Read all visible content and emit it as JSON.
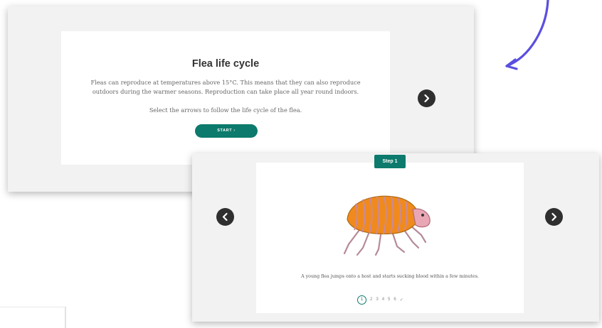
{
  "panel1": {
    "title": "Flea life cycle",
    "body": "Fleas can reproduce at temperatures above 15°C. This means that they can also reproduce outdoors during the warmer seasons. Reproduction can take place all year round indoors.",
    "instruction": "Select the arrows to follow the life cycle of the flea.",
    "start_label": "START ›"
  },
  "panel2": {
    "step_badge": "Step 1",
    "caption": "A young flea jumps onto a host and starts sucking blood within a few minutes.",
    "pager": {
      "current": "1",
      "pages": [
        "2",
        "3",
        "4",
        "5",
        "6"
      ],
      "done_glyph": "✓"
    }
  },
  "icons": {
    "next": "chevron-right-icon",
    "prev": "chevron-left-icon",
    "decorative_arrow": "curved-arrow-icon",
    "illustration": "flea-illustration"
  },
  "colors": {
    "accent": "#0c7a6c",
    "nav_button": "#2f2f2f",
    "decorative_arrow": "#5a4fe0",
    "flea_body": "#f08a1c"
  }
}
